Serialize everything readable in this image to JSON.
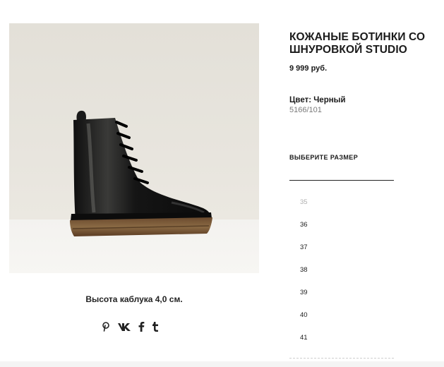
{
  "product": {
    "title": "КОЖАНЫЕ БОТИНКИ СО ШНУРОВКОЙ STUDIO",
    "price": "9 999 руб.",
    "color_line": "Цвет: Черный",
    "sku": "5166/101",
    "heel_height": "Высота каблука 4,0 см."
  },
  "size_selector": {
    "title": "ВЫБЕРИТЕ РАЗМЕР",
    "sizes": [
      {
        "label": "35",
        "available": false
      },
      {
        "label": "36",
        "available": true
      },
      {
        "label": "37",
        "available": true
      },
      {
        "label": "38",
        "available": true
      },
      {
        "label": "39",
        "available": true
      },
      {
        "label": "40",
        "available": true
      },
      {
        "label": "41",
        "available": true
      }
    ]
  },
  "share": {
    "icons": [
      "pinterest-icon",
      "vk-icon",
      "facebook-icon",
      "tumblr-icon"
    ]
  },
  "colors": {
    "text": "#1a1a1a",
    "muted": "#7a7a7a",
    "disabled": "#b0b0b0",
    "photo_bg": "#e6e3dc"
  }
}
